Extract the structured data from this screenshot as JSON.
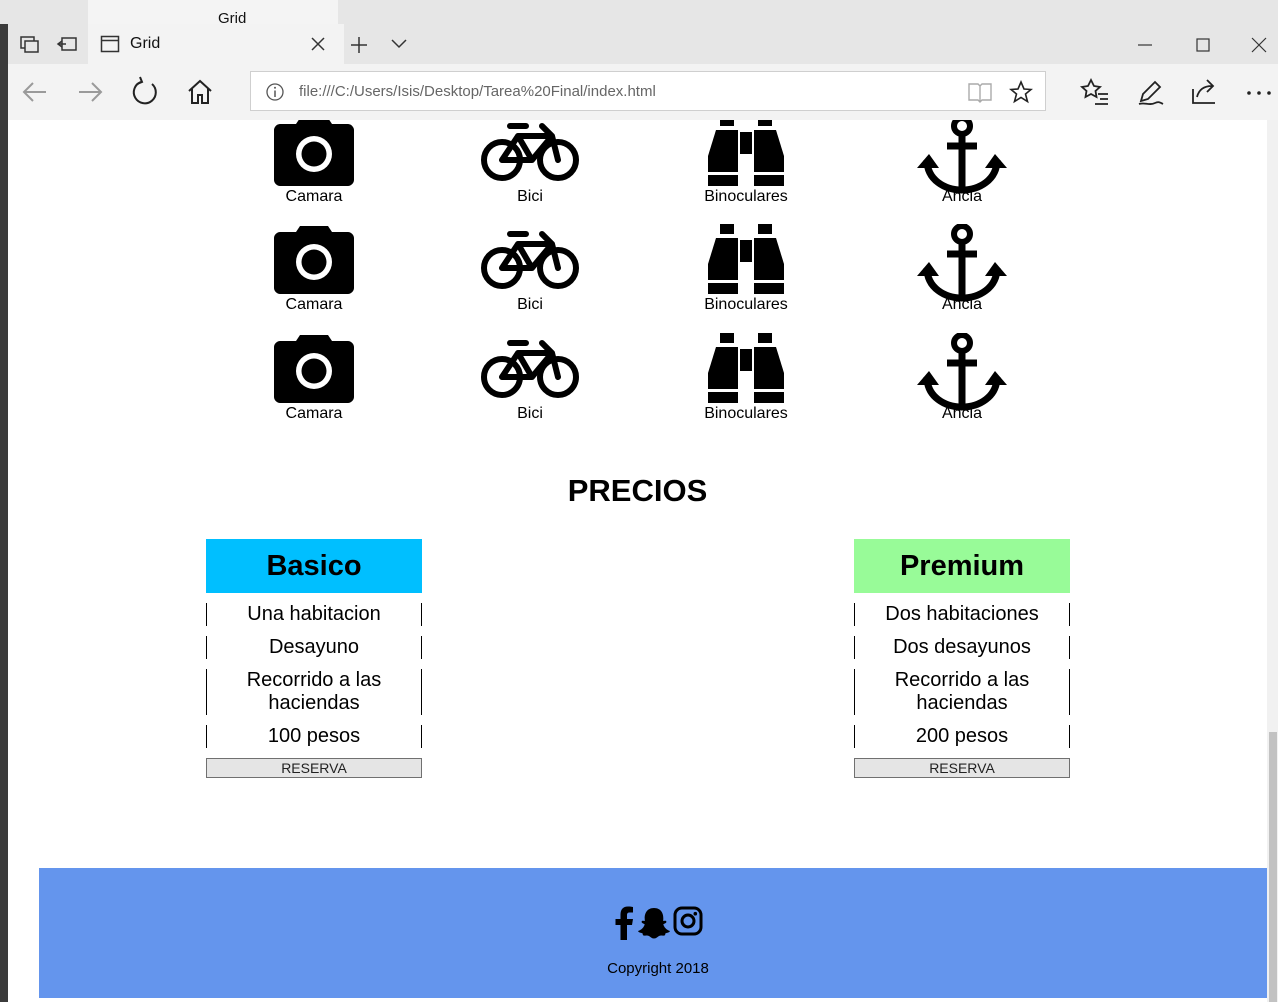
{
  "browser": {
    "tab_title": "Grid",
    "url": "file:///C:/Users/Isis/Desktop/Tarea%20Final/index.html"
  },
  "gallery": {
    "rows": [
      [
        "Camara",
        "Bici",
        "Binoculares",
        "Ancla"
      ],
      [
        "Camara",
        "Bici",
        "Binoculares",
        "Ancla"
      ],
      [
        "Camara",
        "Bici",
        "Binoculares",
        "Ancla"
      ]
    ],
    "icons": [
      "camera-icon",
      "bicycle-icon",
      "binoculars-icon",
      "anchor-icon"
    ]
  },
  "pricing": {
    "title": "PRECIOS",
    "plans": [
      {
        "name": "Basico",
        "color": "#00bfff",
        "features": [
          "Una habitacion",
          "Desayuno",
          "Recorrido a las haciendas",
          "100 pesos"
        ],
        "button": "RESERVA"
      },
      {
        "name": "Premium",
        "color": "#98fb98",
        "features": [
          "Dos habitaciones",
          "Dos desayunos",
          "Recorrido a las haciendas",
          "200 pesos"
        ],
        "button": "RESERVA"
      }
    ]
  },
  "footer": {
    "background": "#6495ed",
    "social_icons": [
      "facebook-icon",
      "snapchat-icon",
      "instagram-icon"
    ],
    "copyright": "Copyright 2018"
  }
}
